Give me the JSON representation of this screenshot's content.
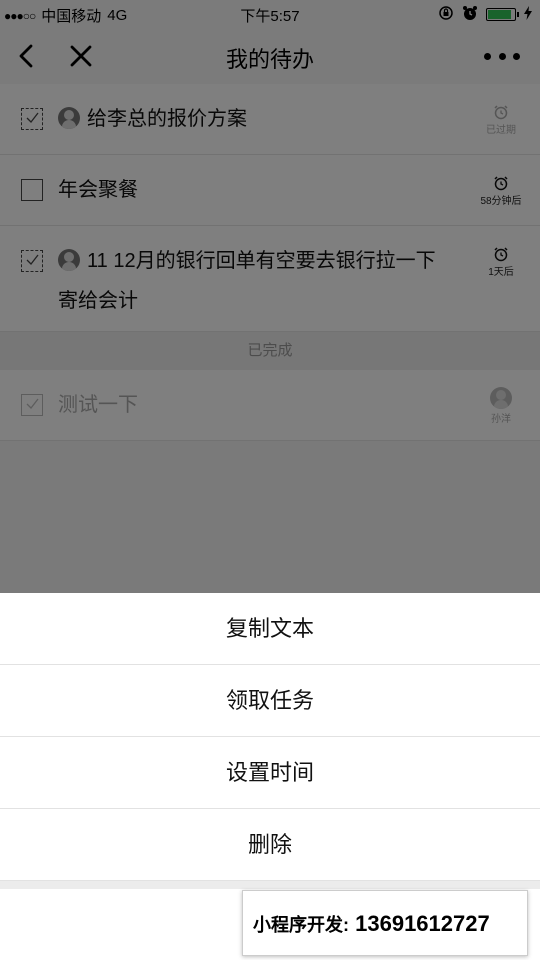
{
  "status_bar": {
    "signal": "●●●○○",
    "carrier": "中国移动",
    "network": "4G",
    "time": "下午5:57",
    "battery_level": 0.9
  },
  "nav": {
    "title": "我的待办",
    "back_icon": "chevron-left-icon",
    "close_icon": "close-icon",
    "more_icon": "more-dots-icon"
  },
  "todos": [
    {
      "text": "给李总的报价方案",
      "checkbox": "dashed-checked",
      "has_avatar": true,
      "alarm_label": "已过期",
      "alarm_faded": true
    },
    {
      "text": "年会聚餐",
      "checkbox": "empty",
      "has_avatar": false,
      "alarm_label": "58分钟后",
      "alarm_faded": false
    },
    {
      "text_line1": "11 12月的银行回单有空要去银行拉一下",
      "text_line2": "寄给会计",
      "checkbox": "dashed-checked",
      "has_avatar": true,
      "alarm_label": "1天后",
      "alarm_faded": false
    }
  ],
  "completed_section": {
    "header": "已完成",
    "items": [
      {
        "text": "测试一下",
        "assignee": "孙洋"
      }
    ]
  },
  "action_sheet": {
    "items": [
      "复制文本",
      "领取任务",
      "设置时间",
      "删除"
    ]
  },
  "watermark": {
    "label": "小程序开发:",
    "phone": "13691612727"
  },
  "colors": {
    "overlay": "#000000",
    "battery": "#34c759"
  }
}
